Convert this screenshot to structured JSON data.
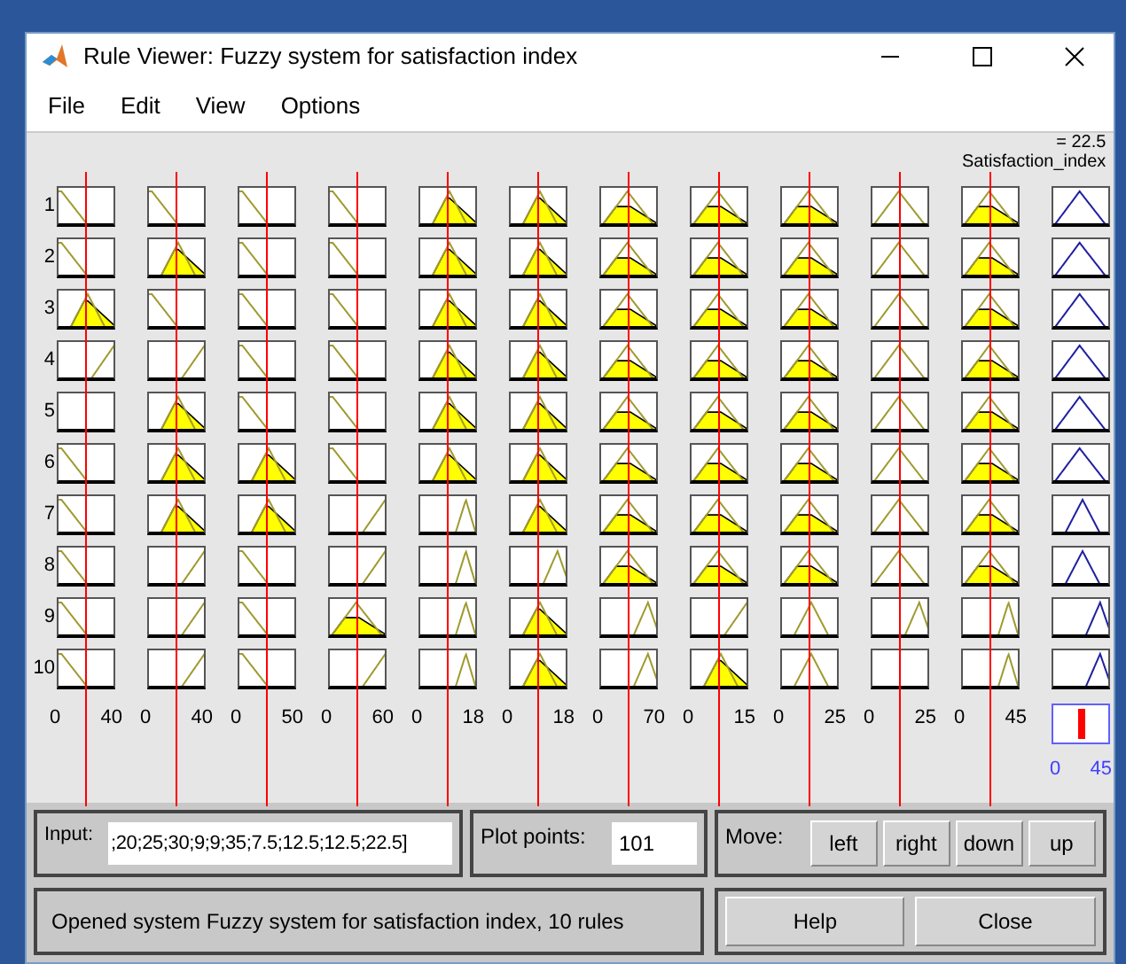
{
  "window": {
    "title": "Rule Viewer: Fuzzy system for satisfaction index"
  },
  "menu": [
    "File",
    "Edit",
    "View",
    "Options"
  ],
  "output_header": {
    "value": "= 22.5",
    "label": "Satisfaction_index"
  },
  "rules": [
    "1",
    "2",
    "3",
    "4",
    "5",
    "6",
    "7",
    "8",
    "9",
    "10"
  ],
  "inputs": [
    {
      "range": [
        "0",
        "40"
      ],
      "cells": [
        {
          "kind": "z",
          "active": false
        },
        {
          "kind": "z",
          "active": false
        },
        {
          "kind": "tri-c",
          "active": true
        },
        {
          "kind": "s",
          "active": false
        },
        {
          "kind": "none",
          "active": false
        },
        {
          "kind": "z",
          "active": false
        },
        {
          "kind": "z",
          "active": false
        },
        {
          "kind": "z",
          "active": false
        },
        {
          "kind": "z",
          "active": false
        },
        {
          "kind": "z",
          "active": false
        }
      ]
    },
    {
      "range": [
        "0",
        "40"
      ],
      "cells": [
        {
          "kind": "z",
          "active": false
        },
        {
          "kind": "tri-c",
          "active": true
        },
        {
          "kind": "z",
          "active": false
        },
        {
          "kind": "s",
          "active": false
        },
        {
          "kind": "tri-c",
          "active": true
        },
        {
          "kind": "tri-c",
          "active": true
        },
        {
          "kind": "tri-c",
          "active": true
        },
        {
          "kind": "s",
          "active": false
        },
        {
          "kind": "s",
          "active": false
        },
        {
          "kind": "s",
          "active": false
        }
      ]
    },
    {
      "range": [
        "0",
        "50"
      ],
      "cells": [
        {
          "kind": "z",
          "active": false
        },
        {
          "kind": "z",
          "active": false
        },
        {
          "kind": "z",
          "active": false
        },
        {
          "kind": "z",
          "active": false
        },
        {
          "kind": "z",
          "active": false
        },
        {
          "kind": "tri-c",
          "active": true
        },
        {
          "kind": "tri-c",
          "active": true
        },
        {
          "kind": "z",
          "active": false
        },
        {
          "kind": "z",
          "active": false
        },
        {
          "kind": "z",
          "active": false
        }
      ]
    },
    {
      "range": [
        "0",
        "60"
      ],
      "cells": [
        {
          "kind": "z",
          "active": false
        },
        {
          "kind": "z",
          "active": false
        },
        {
          "kind": "z",
          "active": false
        },
        {
          "kind": "z",
          "active": false
        },
        {
          "kind": "z",
          "active": false
        },
        {
          "kind": "z",
          "active": false
        },
        {
          "kind": "s",
          "active": false
        },
        {
          "kind": "s",
          "active": false
        },
        {
          "kind": "tri-l",
          "active": true
        },
        {
          "kind": "s",
          "active": false
        }
      ]
    },
    {
      "range": [
        "0",
        "18"
      ],
      "cells": [
        {
          "kind": "tri-c",
          "active": true
        },
        {
          "kind": "tri-c",
          "active": true
        },
        {
          "kind": "tri-c",
          "active": true
        },
        {
          "kind": "tri-c",
          "active": true
        },
        {
          "kind": "tri-c",
          "active": true
        },
        {
          "kind": "tri-c",
          "active": true
        },
        {
          "kind": "tri-n",
          "active": false
        },
        {
          "kind": "tri-n",
          "active": false
        },
        {
          "kind": "tri-n",
          "active": false
        },
        {
          "kind": "tri-n",
          "active": false
        }
      ]
    },
    {
      "range": [
        "0",
        "18"
      ],
      "cells": [
        {
          "kind": "tri-c",
          "active": true
        },
        {
          "kind": "tri-c",
          "active": true
        },
        {
          "kind": "tri-c",
          "active": true
        },
        {
          "kind": "tri-c",
          "active": true
        },
        {
          "kind": "tri-c",
          "active": true
        },
        {
          "kind": "tri-c",
          "active": true
        },
        {
          "kind": "tri-c",
          "active": true
        },
        {
          "kind": "tri-r",
          "active": false
        },
        {
          "kind": "tri-c",
          "active": true
        },
        {
          "kind": "tri-c",
          "active": true
        }
      ]
    },
    {
      "range": [
        "0",
        "70"
      ],
      "cells": [
        {
          "kind": "tri-l",
          "active": true
        },
        {
          "kind": "tri-l",
          "active": true
        },
        {
          "kind": "tri-l",
          "active": true
        },
        {
          "kind": "tri-l",
          "active": true
        },
        {
          "kind": "tri-l",
          "active": true
        },
        {
          "kind": "tri-l",
          "active": true
        },
        {
          "kind": "tri-l",
          "active": true
        },
        {
          "kind": "tri-l",
          "active": true
        },
        {
          "kind": "tri-r",
          "active": false
        },
        {
          "kind": "tri-r",
          "active": false
        }
      ]
    },
    {
      "range": [
        "0",
        "15"
      ],
      "cells": [
        {
          "kind": "tri-l",
          "active": true
        },
        {
          "kind": "tri-l",
          "active": true
        },
        {
          "kind": "tri-l",
          "active": true
        },
        {
          "kind": "tri-l",
          "active": true
        },
        {
          "kind": "tri-l",
          "active": true
        },
        {
          "kind": "tri-l",
          "active": true
        },
        {
          "kind": "tri-l",
          "active": true
        },
        {
          "kind": "tri-l",
          "active": true
        },
        {
          "kind": "s",
          "active": false
        },
        {
          "kind": "tri-c",
          "active": true
        }
      ]
    },
    {
      "range": [
        "0",
        "25"
      ],
      "cells": [
        {
          "kind": "tri-l",
          "active": true
        },
        {
          "kind": "tri-l",
          "active": true
        },
        {
          "kind": "tri-l",
          "active": true
        },
        {
          "kind": "tri-l",
          "active": true
        },
        {
          "kind": "tri-l",
          "active": true
        },
        {
          "kind": "tri-l",
          "active": true
        },
        {
          "kind": "tri-l",
          "active": true
        },
        {
          "kind": "tri-l",
          "active": true
        },
        {
          "kind": "tri-c",
          "active": false
        },
        {
          "kind": "tri-c",
          "active": false
        }
      ]
    },
    {
      "range": [
        "0",
        "25"
      ],
      "cells": [
        {
          "kind": "tri-l",
          "active": false
        },
        {
          "kind": "tri-l",
          "active": false
        },
        {
          "kind": "tri-l",
          "active": false
        },
        {
          "kind": "tri-l",
          "active": false
        },
        {
          "kind": "tri-l",
          "active": false
        },
        {
          "kind": "tri-l",
          "active": false
        },
        {
          "kind": "tri-l",
          "active": false
        },
        {
          "kind": "tri-l",
          "active": false
        },
        {
          "kind": "tri-r",
          "active": false
        },
        {
          "kind": "none",
          "active": false
        }
      ]
    },
    {
      "range": [
        "0",
        "45"
      ],
      "cells": [
        {
          "kind": "tri-l",
          "active": true
        },
        {
          "kind": "tri-l",
          "active": true
        },
        {
          "kind": "tri-l",
          "active": true
        },
        {
          "kind": "tri-l",
          "active": true
        },
        {
          "kind": "tri-l",
          "active": true
        },
        {
          "kind": "tri-l",
          "active": true
        },
        {
          "kind": "tri-l",
          "active": true
        },
        {
          "kind": "tri-l",
          "active": true
        },
        {
          "kind": "tri-n",
          "active": false
        },
        {
          "kind": "tri-n",
          "active": false
        }
      ]
    }
  ],
  "output": {
    "range": [
      "0",
      "45"
    ],
    "cells": [
      {
        "kind": "tri-l"
      },
      {
        "kind": "tri-l"
      },
      {
        "kind": "tri-l"
      },
      {
        "kind": "tri-l"
      },
      {
        "kind": "tri-l"
      },
      {
        "kind": "tri-l"
      },
      {
        "kind": "tri-c"
      },
      {
        "kind": "tri-c"
      },
      {
        "kind": "tri-r"
      },
      {
        "kind": "tri-r"
      }
    ]
  },
  "input": {
    "label": "Input:",
    "value": ";20;25;30;9;9;35;7.5;12.5;12.5;22.5]"
  },
  "plot_points": {
    "label": "Plot points:",
    "value": "101"
  },
  "move": {
    "label": "Move:",
    "buttons": [
      "left",
      "right",
      "down",
      "up"
    ]
  },
  "status": "Opened system Fuzzy system for satisfaction index, 10 rules",
  "buttons": [
    "Help",
    "Close"
  ]
}
